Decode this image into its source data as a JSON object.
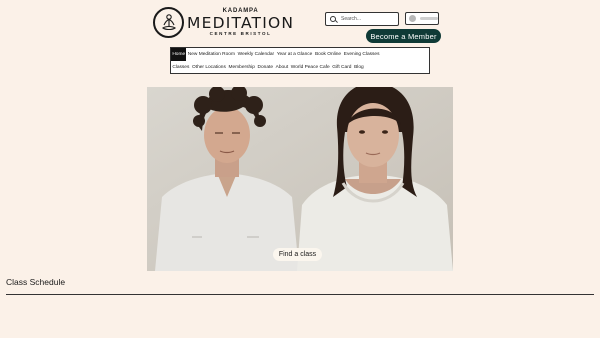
{
  "brand": {
    "top": "KADAMPA",
    "main": "MEDITATION",
    "sub": "CENTRE BRISTOL",
    "logo_icon": "meditating-figure-icon"
  },
  "search": {
    "placeholder": "Search..."
  },
  "header": {
    "member_button": "Become a Member"
  },
  "nav": {
    "row1": [
      "Home",
      "New Meditation Room",
      "Weekly Calendar",
      "Year at a Glance",
      "Book Online",
      "Evening Classes"
    ],
    "row2": [
      "Classes",
      "Other Locations",
      "Membership",
      "Donate",
      "About",
      "World Peace Cafe",
      "Gift Card",
      "Blog"
    ],
    "active": "Home"
  },
  "hero": {
    "button": "Find a class"
  },
  "main": {
    "section_title": "Class Schedule"
  },
  "colors": {
    "background": "#fbf1e8",
    "accent": "#0f3a36",
    "nav_active": "#111111"
  }
}
